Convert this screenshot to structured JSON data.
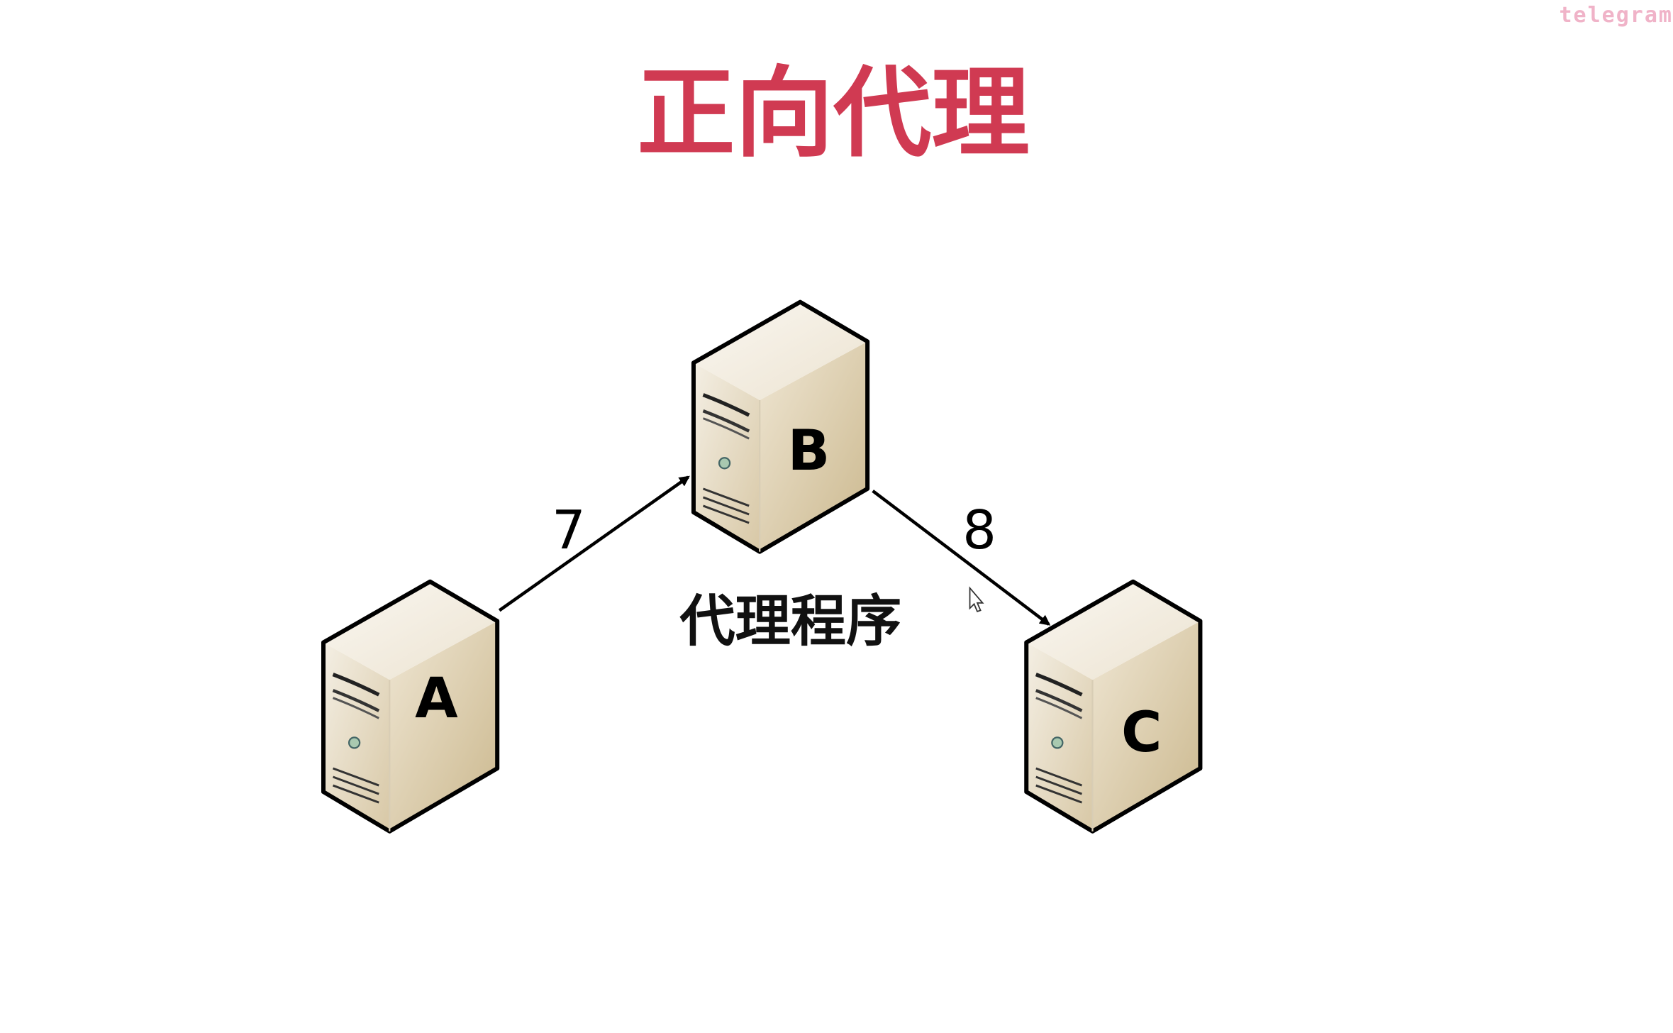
{
  "watermark": "telegram",
  "title": "正向代理",
  "title_color": "#d03a52",
  "servers": [
    {
      "label": "A"
    },
    {
      "label": "B"
    },
    {
      "label": "C"
    }
  ],
  "edges": [
    {
      "from": "A",
      "to": "B",
      "label": "7"
    },
    {
      "from": "B",
      "to": "C",
      "label": "8"
    }
  ],
  "proxy_caption": "代理程序",
  "icons": {
    "server": "server-icon",
    "cursor": "mouse-cursor-icon"
  }
}
